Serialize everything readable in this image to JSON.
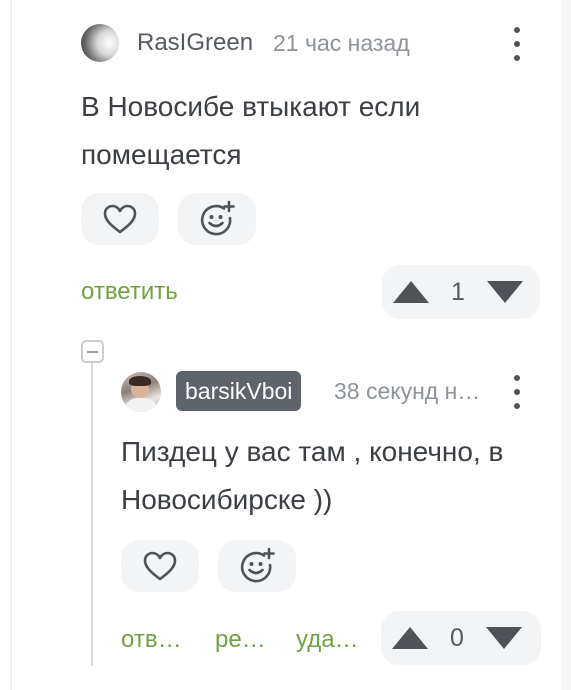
{
  "comment1": {
    "username": "RasIGreen",
    "time": "21 час назад",
    "text": "В Новосибе втыкают если помещается",
    "reply_label": "ответить",
    "rating": "1"
  },
  "comment2": {
    "username": "barsikVboi",
    "time": "38 секунд н…",
    "text": "Пиздец у вас там , конечно, в Новосибирске ))",
    "actions": {
      "reply": "отв…",
      "edit": "ре…",
      "delete": "уда…"
    },
    "rating": "0"
  },
  "colors": {
    "accent_green": "#6fa240",
    "username_badge": "#5f646b",
    "button_bg": "#f3f4f6"
  },
  "icons": {
    "like": "heart-icon",
    "reaction": "emoji-add-icon",
    "more": "kebab-menu-icon",
    "upvote": "triangle-up-icon",
    "downvote": "triangle-down-icon",
    "collapse": "minus-square-icon"
  }
}
